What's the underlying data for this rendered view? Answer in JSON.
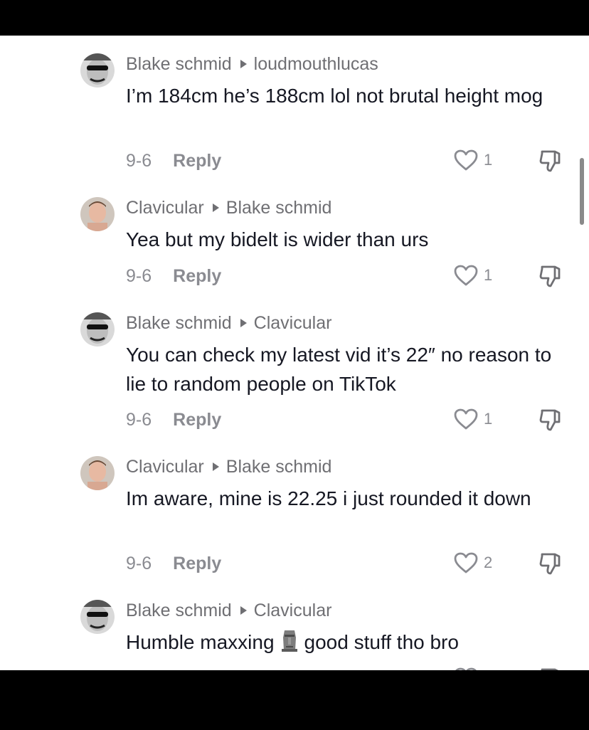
{
  "comments": [
    {
      "author": "Blake schmid",
      "reply_to": "loudmouthlucas",
      "text": "I’m 184cm he’s 188cm lol not brutal height mog",
      "date": "9-6",
      "reply_label": "Reply",
      "likes": "1",
      "avatar": "blake"
    },
    {
      "author": "Clavicular",
      "reply_to": "Blake schmid",
      "text": "Yea but my bidelt is wider than urs",
      "date": "9-6",
      "reply_label": "Reply",
      "likes": "1",
      "avatar": "clavicular"
    },
    {
      "author": "Blake schmid",
      "reply_to": "Clavicular",
      "text": "You can check my latest vid it’s 22″ no reason to lie to random people on TikTok",
      "date": "9-6",
      "reply_label": "Reply",
      "likes": "1",
      "avatar": "blake"
    },
    {
      "author": "Clavicular",
      "reply_to": "Blake schmid",
      "text": "Im aware, mine is 22.25 i just rounded it down",
      "date": "9-6",
      "reply_label": "Reply",
      "likes": "2",
      "avatar": "clavicular"
    },
    {
      "author": "Blake schmid",
      "reply_to": "Clavicular",
      "text_before_emoji": "Humble maxxing",
      "emoji": "moai-emoji",
      "text_after_emoji": "good stuff tho bro",
      "avatar": "blake"
    }
  ],
  "icons": {
    "like": "heart-outline-icon",
    "dislike": "thumbs-down-icon",
    "reply_arrow": "triangle-right-icon"
  },
  "colors": {
    "name": "#6f6f73",
    "text": "#161823",
    "meta": "#8a8b91"
  }
}
